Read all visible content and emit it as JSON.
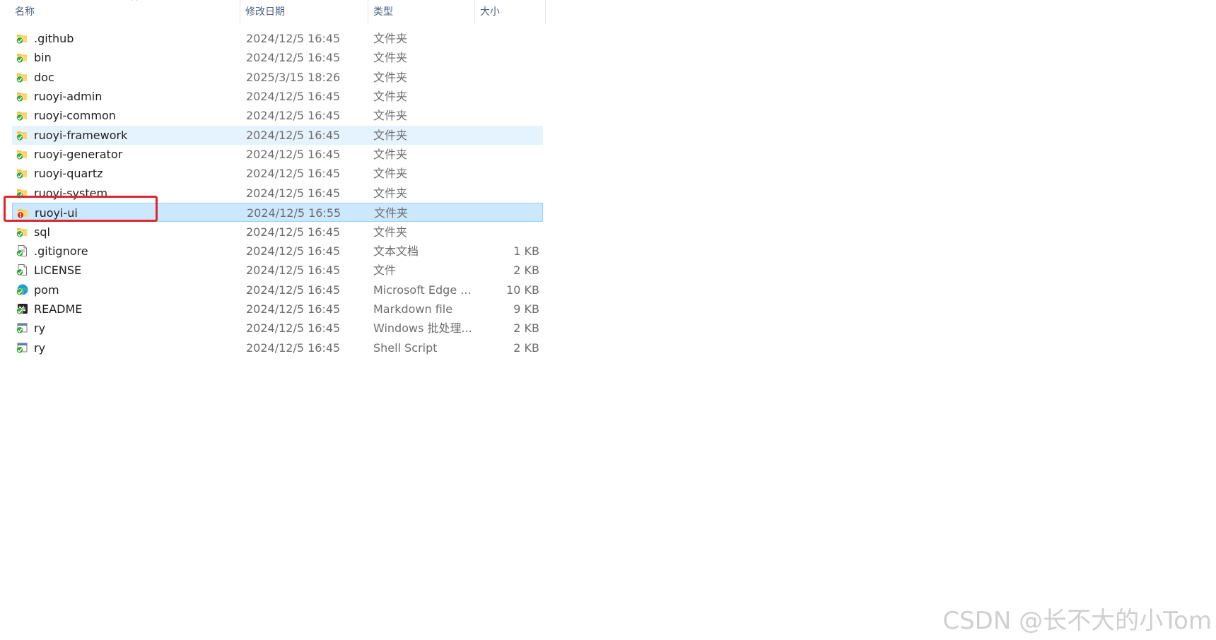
{
  "columns": {
    "name": "名称",
    "date": "修改日期",
    "type": "类型",
    "size": "大小"
  },
  "sort_indicator": "^",
  "rows": [
    {
      "name": ".github",
      "date": "2024/12/5 16:45",
      "type": "文件夹",
      "size": "",
      "icon": "folder-git-ok-icon"
    },
    {
      "name": "bin",
      "date": "2024/12/5 16:45",
      "type": "文件夹",
      "size": "",
      "icon": "folder-git-ok-icon"
    },
    {
      "name": "doc",
      "date": "2025/3/15 18:26",
      "type": "文件夹",
      "size": "",
      "icon": "folder-git-ok-icon"
    },
    {
      "name": "ruoyi-admin",
      "date": "2024/12/5 16:45",
      "type": "文件夹",
      "size": "",
      "icon": "folder-git-ok-icon"
    },
    {
      "name": "ruoyi-common",
      "date": "2024/12/5 16:45",
      "type": "文件夹",
      "size": "",
      "icon": "folder-git-ok-icon"
    },
    {
      "name": "ruoyi-framework",
      "date": "2024/12/5 16:45",
      "type": "文件夹",
      "size": "",
      "icon": "folder-git-ok-icon"
    },
    {
      "name": "ruoyi-generator",
      "date": "2024/12/5 16:45",
      "type": "文件夹",
      "size": "",
      "icon": "folder-git-ok-icon"
    },
    {
      "name": "ruoyi-quartz",
      "date": "2024/12/5 16:45",
      "type": "文件夹",
      "size": "",
      "icon": "folder-git-ok-icon"
    },
    {
      "name": "ruoyi-system",
      "date": "2024/12/5 16:45",
      "type": "文件夹",
      "size": "",
      "icon": "folder-git-ok-icon"
    },
    {
      "name": "ruoyi-ui",
      "date": "2024/12/5 16:55",
      "type": "文件夹",
      "size": "",
      "icon": "folder-git-modified-icon"
    },
    {
      "name": "sql",
      "date": "2024/12/5 16:45",
      "type": "文件夹",
      "size": "",
      "icon": "folder-git-ok-icon"
    },
    {
      "name": ".gitignore",
      "date": "2024/12/5 16:45",
      "type": "文本文档",
      "size": "1 KB",
      "icon": "text-file-git-ok-icon"
    },
    {
      "name": "LICENSE",
      "date": "2024/12/5 16:45",
      "type": "文件",
      "size": "2 KB",
      "icon": "file-git-ok-icon"
    },
    {
      "name": "pom",
      "date": "2024/12/5 16:45",
      "type": "Microsoft Edge ...",
      "size": "10 KB",
      "icon": "edge-file-git-ok-icon"
    },
    {
      "name": "README",
      "date": "2024/12/5 16:45",
      "type": "Markdown file",
      "size": "9 KB",
      "icon": "markdown-file-git-ok-icon"
    },
    {
      "name": "ry",
      "date": "2024/12/5 16:45",
      "type": "Windows 批处理...",
      "size": "2 KB",
      "icon": "batch-file-git-ok-icon"
    },
    {
      "name": "ry",
      "date": "2024/12/5 16:45",
      "type": "Shell Script",
      "size": "2 KB",
      "icon": "script-file-git-ok-icon"
    }
  ],
  "hover_row": "ruoyi-framework",
  "selected_row": "ruoyi-ui",
  "colors": {
    "hover": "#e5f3ff",
    "selected": "#cce8ff",
    "annotation": "#e0262b",
    "git_ok": "#3aa53a",
    "git_modified": "#d9331f"
  },
  "watermark": "CSDN @长不大的小Tom"
}
